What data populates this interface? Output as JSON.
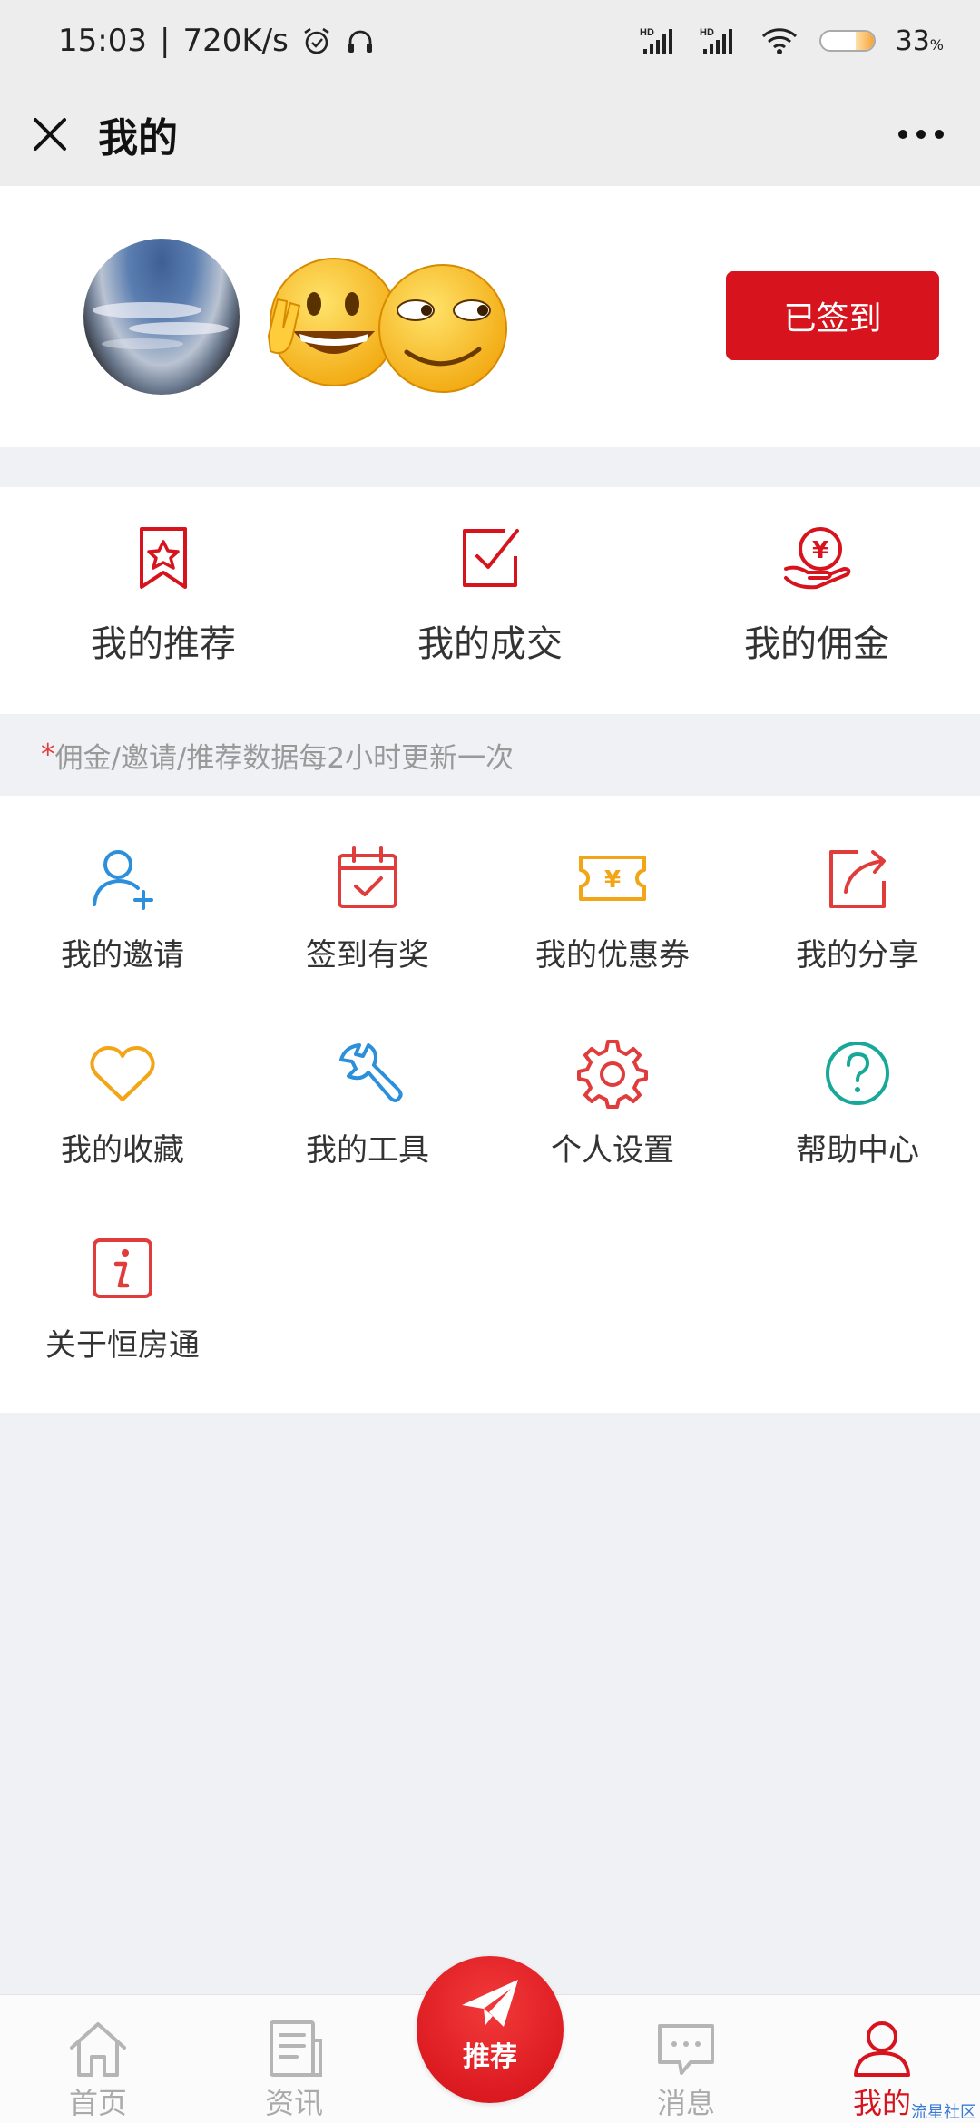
{
  "status_bar": {
    "time": "15:03",
    "network_speed": "720K/s",
    "battery_level": "33",
    "battery_unit": "%"
  },
  "title_bar": {
    "title": "我的"
  },
  "profile": {
    "sign_status_button": "已签到"
  },
  "stats": [
    {
      "label": "我的推荐",
      "icon": "bookmark-star-icon"
    },
    {
      "label": "我的成交",
      "icon": "checkbox-icon"
    },
    {
      "label": "我的佣金",
      "icon": "coin-hand-icon"
    }
  ],
  "notice": {
    "mark": "*",
    "text": "佣金/邀请/推荐数据每2小时更新一次"
  },
  "menu": [
    {
      "label": "我的邀请",
      "icon": "add-user-icon",
      "color": "#2b8fdc"
    },
    {
      "label": "签到有奖",
      "icon": "calendar-check-icon",
      "color": "#e03c3c"
    },
    {
      "label": "我的优惠券",
      "icon": "coupon-icon",
      "color": "#f2a516"
    },
    {
      "label": "我的分享",
      "icon": "share-icon",
      "color": "#e03c3c"
    },
    {
      "label": "我的收藏",
      "icon": "heart-icon",
      "color": "#f2a516"
    },
    {
      "label": "我的工具",
      "icon": "wrench-icon",
      "color": "#2b8fdc"
    },
    {
      "label": "个人设置",
      "icon": "gear-icon",
      "color": "#e03c3c"
    },
    {
      "label": "帮助中心",
      "icon": "help-icon",
      "color": "#17a89a"
    },
    {
      "label": "关于恒房通",
      "icon": "info-icon",
      "color": "#e03c3c"
    }
  ],
  "tabs": {
    "home": "首页",
    "news": "资讯",
    "recommend": "推荐",
    "messages": "消息",
    "mine": "我的"
  },
  "watermark": "流星社区",
  "colors": {
    "brand_red": "#d7141d",
    "inactive_tab": "#aaaaaa"
  }
}
